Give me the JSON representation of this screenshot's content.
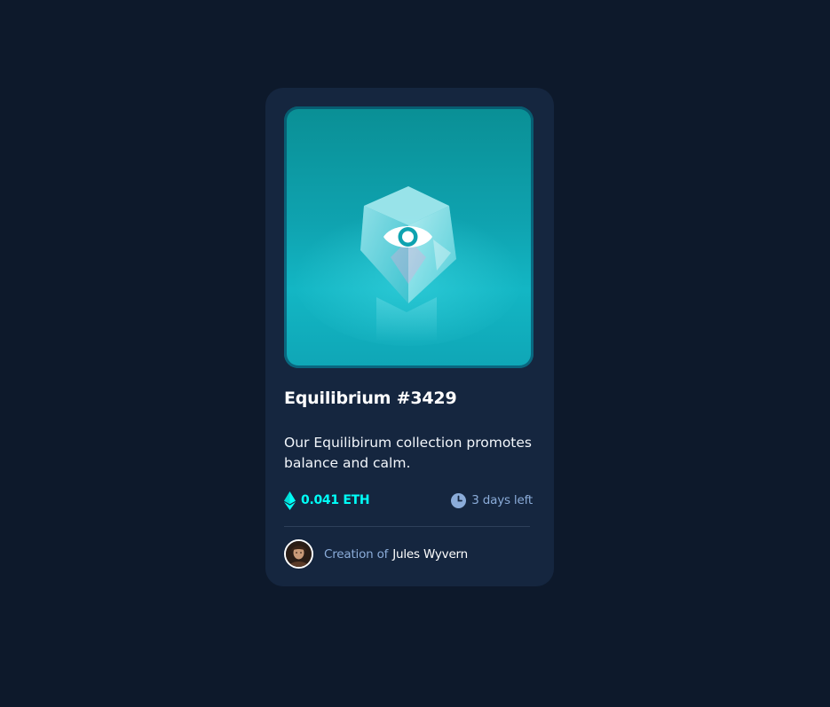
{
  "card": {
    "image_alt": "Equilibrium",
    "overlay_icon": "eye-icon",
    "title": "Equilibrium #3429",
    "description": "Our Equilibirum collection promotes balance and calm.",
    "price": {
      "icon": "ethereum-icon",
      "value": "0.041 ETH"
    },
    "time_left": {
      "icon": "clock-icon",
      "value": "3 days left"
    },
    "creator": {
      "prefix": "Creation of",
      "name": "Jules Wyvern"
    }
  },
  "colors": {
    "page_background": "#0d192b",
    "card_background": "#15263f",
    "accent_cyan": "#00fff8",
    "soft_blue": "#8bacd9",
    "divider": "#2e405a",
    "white": "#ffffff"
  }
}
